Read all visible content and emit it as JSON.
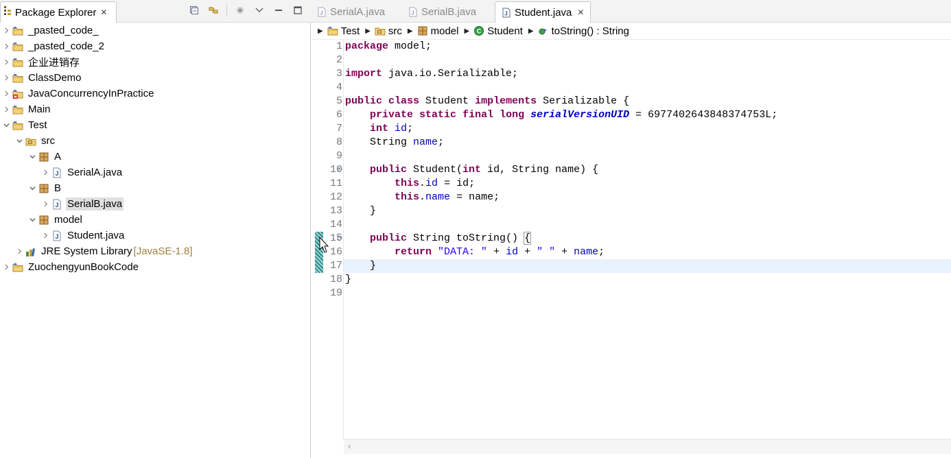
{
  "explorer": {
    "title": "Package Explorer",
    "close": "✕",
    "tree": [
      {
        "label": "_pasted_code_",
        "icon": "project-icon",
        "depth": 0,
        "expanded": false
      },
      {
        "label": "_pasted_code_2",
        "icon": "project-icon",
        "depth": 0,
        "expanded": false
      },
      {
        "label": "企业进销存",
        "icon": "project-icon",
        "depth": 0,
        "expanded": false
      },
      {
        "label": "ClassDemo",
        "icon": "project-icon",
        "depth": 0,
        "expanded": false
      },
      {
        "label": "JavaConcurrencyInPractice",
        "icon": "project-error-icon",
        "depth": 0,
        "expanded": false
      },
      {
        "label": "Main",
        "icon": "project-icon",
        "depth": 0,
        "expanded": false
      },
      {
        "label": "Test",
        "icon": "project-icon",
        "depth": 0,
        "expanded": true
      },
      {
        "label": "src",
        "icon": "source-folder-icon",
        "depth": 1,
        "expanded": true
      },
      {
        "label": "A",
        "icon": "package-icon",
        "depth": 2,
        "expanded": true
      },
      {
        "label": "SerialA.java",
        "icon": "java-file-icon",
        "depth": 3,
        "expanded": false
      },
      {
        "label": "B",
        "icon": "package-icon",
        "depth": 2,
        "expanded": true
      },
      {
        "label": "SerialB.java",
        "icon": "java-file-icon",
        "depth": 3,
        "expanded": false,
        "selected": true
      },
      {
        "label": "model",
        "icon": "package-icon",
        "depth": 2,
        "expanded": true
      },
      {
        "label": "Student.java",
        "icon": "java-file-icon",
        "depth": 3,
        "expanded": false
      },
      {
        "label": "JRE System Library",
        "decoration": "[JavaSE-1.8]",
        "icon": "library-icon",
        "depth": 1,
        "expanded": false
      },
      {
        "label": "ZuochengyunBookCode",
        "icon": "project-icon",
        "depth": 0,
        "expanded": false
      }
    ]
  },
  "editor": {
    "tabs": [
      {
        "label": "SerialA.java",
        "active": false
      },
      {
        "label": "SerialB.java",
        "active": false
      },
      {
        "label": "Student.java",
        "active": true
      }
    ],
    "close": "✕",
    "breadcrumb": [
      {
        "label": "Test",
        "icon": "project-icon"
      },
      {
        "label": "src",
        "icon": "source-folder-icon"
      },
      {
        "label": "model",
        "icon": "package-icon"
      },
      {
        "label": "Student",
        "icon": "class-icon"
      },
      {
        "label": "toString() : String",
        "icon": "method-icon"
      }
    ],
    "current_line": 17,
    "lines": [
      [
        [
          "kw",
          "package"
        ],
        [
          "t",
          " model;"
        ]
      ],
      [],
      [
        [
          "kw",
          "import"
        ],
        [
          "t",
          " java.io.Serializable;"
        ]
      ],
      [],
      [
        [
          "kw",
          "public"
        ],
        [
          "t",
          " "
        ],
        [
          "kw",
          "class"
        ],
        [
          "t",
          " Student "
        ],
        [
          "kw",
          "implements"
        ],
        [
          "t",
          " Serializable {"
        ]
      ],
      [
        [
          "t",
          "    "
        ],
        [
          "kw",
          "private"
        ],
        [
          "t",
          " "
        ],
        [
          "kw",
          "static"
        ],
        [
          "t",
          " "
        ],
        [
          "kw",
          "final"
        ],
        [
          "t",
          " "
        ],
        [
          "kw",
          "long"
        ],
        [
          "t",
          " "
        ],
        [
          "sfld",
          "serialVersionUID"
        ],
        [
          "t",
          " = 6977402643848374753L;"
        ]
      ],
      [
        [
          "t",
          "    "
        ],
        [
          "kw",
          "int"
        ],
        [
          "t",
          " "
        ],
        [
          "fld",
          "id"
        ],
        [
          "t",
          ";"
        ]
      ],
      [
        [
          "t",
          "    String "
        ],
        [
          "fld",
          "name"
        ],
        [
          "t",
          ";"
        ]
      ],
      [],
      [
        [
          "t",
          "    "
        ],
        [
          "kw",
          "public"
        ],
        [
          "t",
          " Student("
        ],
        [
          "kw",
          "int"
        ],
        [
          "t",
          " id, String name) {"
        ]
      ],
      [
        [
          "t",
          "        "
        ],
        [
          "kw",
          "this"
        ],
        [
          "t",
          "."
        ],
        [
          "fld",
          "id"
        ],
        [
          "t",
          " = id;"
        ]
      ],
      [
        [
          "t",
          "        "
        ],
        [
          "kw",
          "this"
        ],
        [
          "t",
          "."
        ],
        [
          "fld",
          "name"
        ],
        [
          "t",
          " = name;"
        ]
      ],
      [
        [
          "t",
          "    }"
        ]
      ],
      [],
      [
        [
          "t",
          "    "
        ],
        [
          "kw",
          "public"
        ],
        [
          "t",
          " String toString() "
        ],
        [
          "box",
          "{"
        ]
      ],
      [
        [
          "t",
          "        "
        ],
        [
          "kw",
          "return"
        ],
        [
          "t",
          " "
        ],
        [
          "str",
          "\"DATA: \""
        ],
        [
          "t",
          " + "
        ],
        [
          "fld",
          "id"
        ],
        [
          "t",
          " + "
        ],
        [
          "str",
          "\" \""
        ],
        [
          "t",
          " + "
        ],
        [
          "fld",
          "name"
        ],
        [
          "t",
          ";"
        ]
      ],
      [
        [
          "t",
          "    }"
        ]
      ],
      [
        [
          "t",
          "}"
        ]
      ],
      []
    ],
    "fold_lines": [
      10,
      15
    ],
    "fold_glyph": "⊖"
  }
}
